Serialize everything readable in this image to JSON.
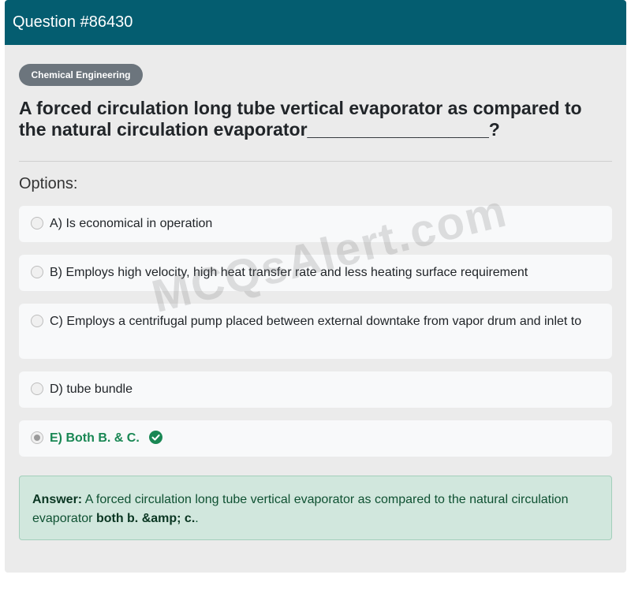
{
  "header": {
    "title": "Question #86430"
  },
  "category": "Chemical Engineering",
  "question": "A forced circulation long tube vertical evaporator as compared to the natural circulation evaporator__________________?",
  "options_label": "Options:",
  "options": [
    {
      "text": "A) Is economical in operation",
      "selected": false
    },
    {
      "text": "B) Employs high velocity, high heat transfer rate and less heating surface requirement",
      "selected": false
    },
    {
      "text": "C) Employs a centrifugal pump placed between external downtake from vapor drum and inlet to",
      "selected": false
    },
    {
      "text": "D) tube bundle",
      "selected": false
    },
    {
      "text": "E) Both B. & C.",
      "selected": true,
      "correct": true
    }
  ],
  "watermark": "MCQsAlert.com",
  "answer": {
    "label": "Answer:",
    "text": " A forced circulation long tube vertical evaporator as compared to the natural circulation evaporator ",
    "highlight": "both b. &amp; c.",
    "suffix": "."
  },
  "icons": {
    "correct": "check-circle-icon"
  },
  "colors": {
    "header": "#045d70",
    "correct": "#198754",
    "answer_bg": "#d1e7dd"
  }
}
